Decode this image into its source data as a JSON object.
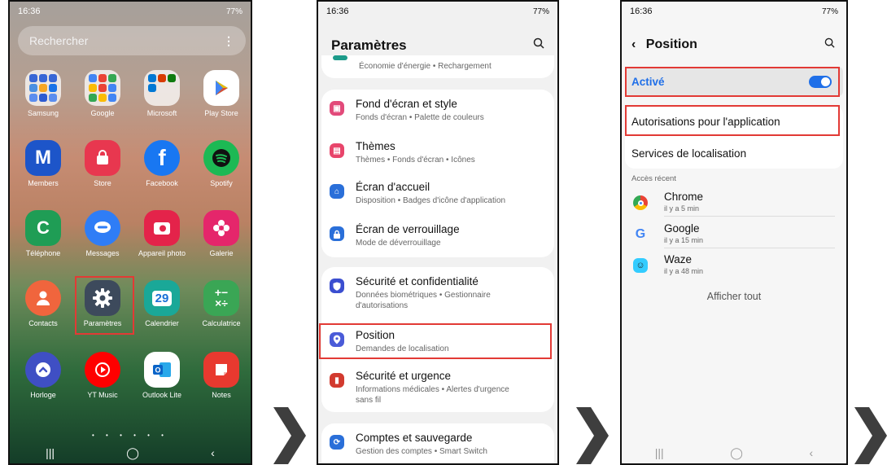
{
  "phone1": {
    "status_time": "16:36",
    "status_right": "77%",
    "search_placeholder": "Rechercher",
    "search_menu": "⋮",
    "apps": [
      {
        "label": "Samsung"
      },
      {
        "label": "Google"
      },
      {
        "label": "Microsoft"
      },
      {
        "label": "Play Store"
      },
      {
        "label": "Members"
      },
      {
        "label": "Store"
      },
      {
        "label": "Facebook"
      },
      {
        "label": "Spotify"
      },
      {
        "label": "Téléphone"
      },
      {
        "label": "Messages"
      },
      {
        "label": "Appareil photo"
      },
      {
        "label": "Galerie"
      },
      {
        "label": "Contacts"
      },
      {
        "label": "Paramètres"
      },
      {
        "label": "Calendrier",
        "icon_text": "29"
      },
      {
        "label": "Calculatrice"
      },
      {
        "label": "Horloge"
      },
      {
        "label": "YT Music"
      },
      {
        "label": "Outlook Lite"
      },
      {
        "label": "Notes"
      }
    ],
    "page_dots": "• • • • • •"
  },
  "phone2": {
    "status_time": "16:36",
    "status_right": "77%",
    "title": "Paramètres",
    "partial_top": "Économie d'énergie • Rechargement",
    "items": [
      {
        "title": "Fond d'écran et style",
        "sub": "Fonds d'écran • Palette de couleurs"
      },
      {
        "title": "Thèmes",
        "sub": "Thèmes • Fonds d'écran • Icônes"
      },
      {
        "title": "Écran d'accueil",
        "sub": "Disposition • Badges d'icône d'application"
      },
      {
        "title": "Écran de verrouillage",
        "sub": "Mode de déverrouillage"
      },
      {
        "title": "Sécurité et confidentialité",
        "sub": "Données biométriques • Gestionnaire d'autorisations"
      },
      {
        "title": "Position",
        "sub": "Demandes de localisation"
      },
      {
        "title": "Sécurité et urgence",
        "sub": "Informations médicales • Alertes d'urgence sans fil"
      },
      {
        "title": "Comptes et sauvegarde",
        "sub": "Gestion des comptes • Smart Switch"
      }
    ]
  },
  "phone3": {
    "status_time": "16:36",
    "status_right": "77%",
    "title": "Position",
    "active_label": "Activé",
    "app_perms": "Autorisations pour l'application",
    "loc_services": "Services de localisation",
    "recent_header": "Accès récent",
    "recent_apps": [
      {
        "name": "Chrome",
        "time": "il y a 5 min"
      },
      {
        "name": "Google",
        "time": "il y a 15 min"
      },
      {
        "name": "Waze",
        "time": "il y a 48 min"
      }
    ],
    "show_all": "Afficher tout"
  },
  "colors": {
    "highlight": "#e23a35",
    "accent_blue": "#1f6fe8"
  }
}
